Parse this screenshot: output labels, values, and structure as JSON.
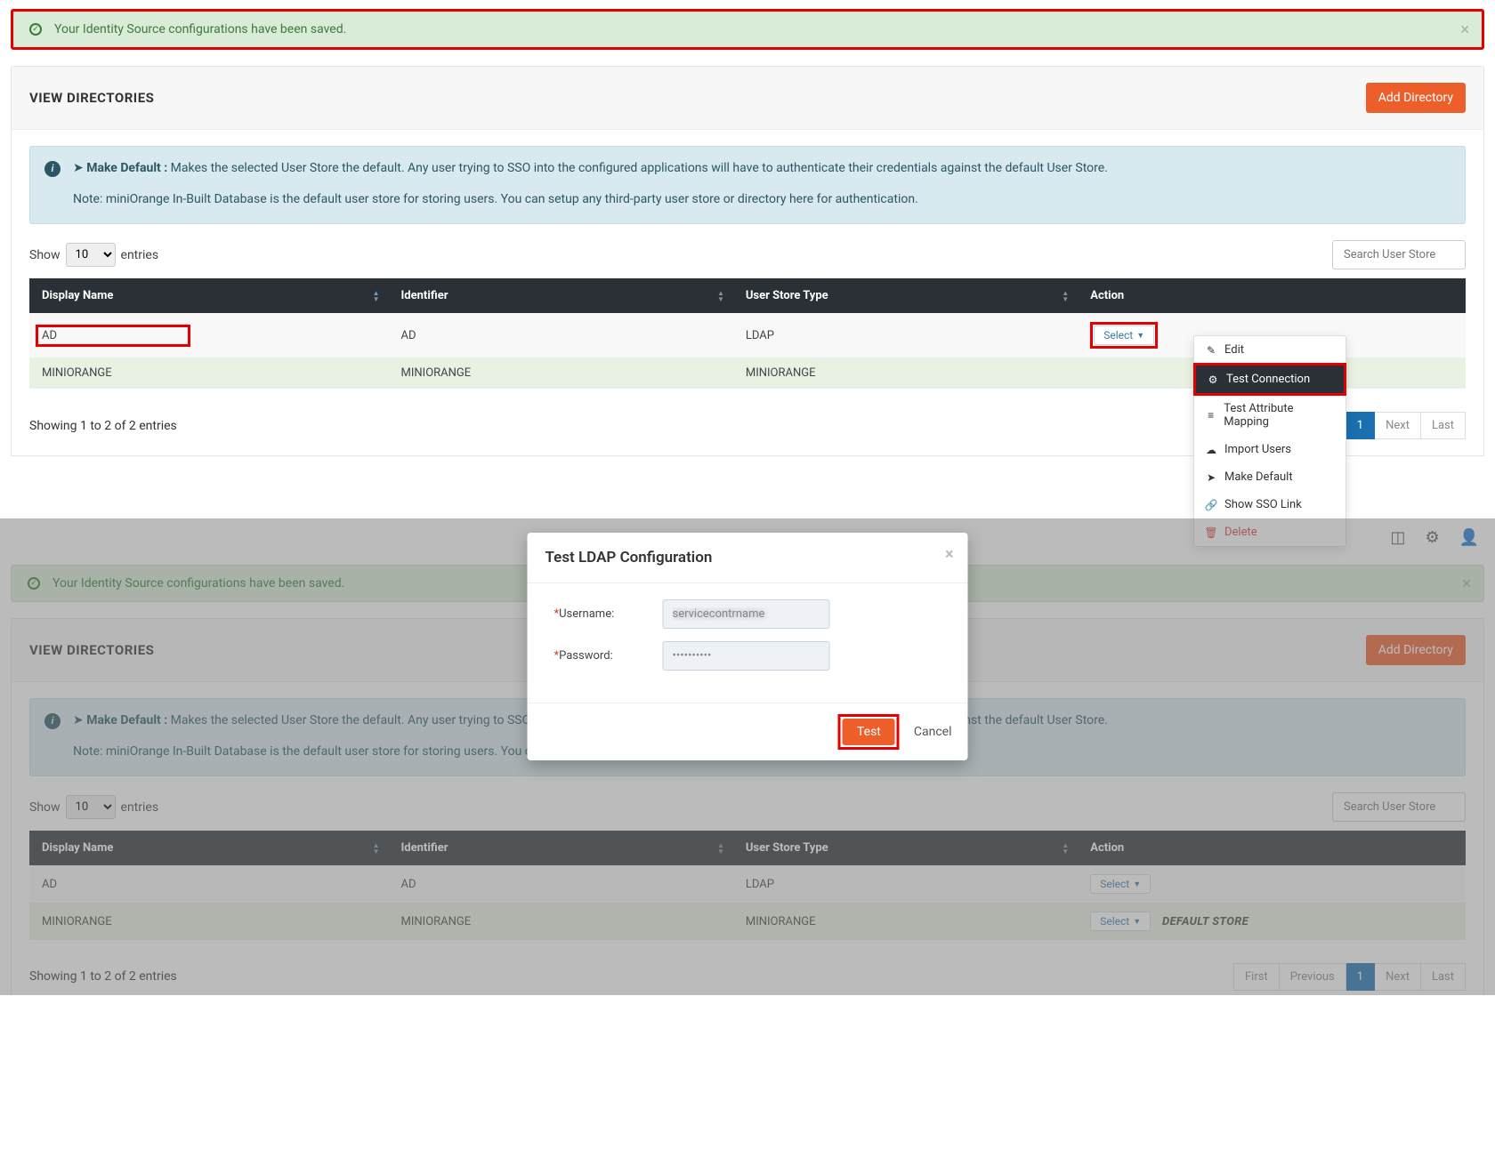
{
  "alert": {
    "message": "Your Identity Source configurations have been saved."
  },
  "panel": {
    "title": "VIEW DIRECTORIES",
    "add_button": "Add Directory",
    "info_lead": "Make Default :",
    "info_body": " Makes the selected User Store the default. Any user trying to SSO into the configured applications will have to authenticate their credentials against the default User Store.",
    "info_note": "Note: miniOrange In-Built Database is the default user store for storing users. You can setup any third-party user store or directory here for authentication."
  },
  "entries": {
    "show_label": "Show",
    "after_label": "entries",
    "count": "10",
    "search_placeholder": "Search User Store"
  },
  "columns": {
    "c1": "Display Name",
    "c2": "Identifier",
    "c3": "User Store Type",
    "c4": "Action"
  },
  "rows": [
    {
      "display": "AD",
      "identifier": "AD",
      "type": "LDAP"
    },
    {
      "display": "MINIORANGE",
      "identifier": "MINIORANGE",
      "type": "MINIORANGE"
    }
  ],
  "select_label": "Select",
  "default_store_label": "DEFAULT STORE",
  "footer_info": "Showing 1 to 2 of 2 entries",
  "pager": {
    "first": "First",
    "prev": "Previous",
    "page": "1",
    "next": "Next",
    "last": "Last"
  },
  "dropdown": {
    "edit": "Edit",
    "test_conn": "Test Connection",
    "test_attr": "Test Attribute Mapping",
    "import": "Import Users",
    "make_default": "Make Default",
    "show_sso": "Show SSO Link",
    "delete": "Delete"
  },
  "modal": {
    "title": "Test LDAP Configuration",
    "username_label": "Username:",
    "password_label": "Password:",
    "username_value": "servicecontrname",
    "password_value": "••••••••••",
    "test": "Test",
    "cancel": "Cancel"
  }
}
